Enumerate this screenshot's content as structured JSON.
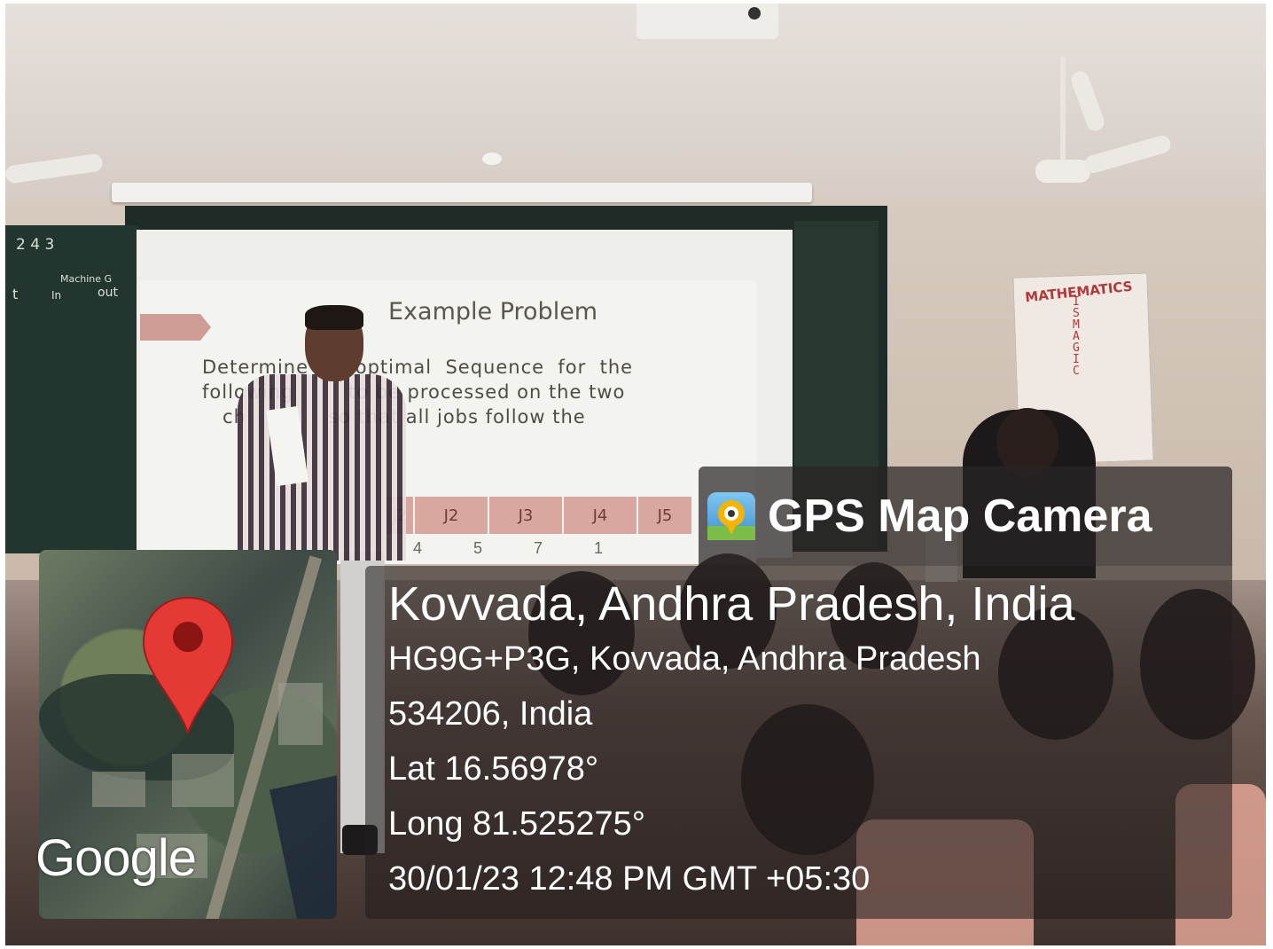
{
  "slide": {
    "title": "Example Problem",
    "lines": [
      "Determine   n  optimal  Sequence  for  the",
      "following        to be processed on the two",
      "   ch            so that all jobs follow the"
    ],
    "table_headers": [
      "J2",
      "J3",
      "J4",
      "J5"
    ],
    "table_values": [
      "4",
      "5",
      "7",
      "1"
    ]
  },
  "blackboard": {
    "number": "2 4 3",
    "header": "Machine G",
    "col_labels": [
      "t",
      "In",
      "out"
    ]
  },
  "poster": {
    "title": "MATHEMATICS",
    "letters": [
      "I",
      "S",
      "M",
      "A",
      "G",
      "I",
      "C"
    ]
  },
  "map": {
    "watermark": "Google",
    "pin_color": "#e53935"
  },
  "badge": {
    "title": "GPS Map Camera"
  },
  "location": {
    "place": "Kovvada, Andhra Pradesh, India",
    "address_line1": "HG9G+P3G, Kovvada, Andhra Pradesh",
    "address_line2": "534206, India",
    "lat": "Lat 16.56978°",
    "long": "Long 81.525275°",
    "datetime": "30/01/23 12:48 PM GMT +05:30"
  }
}
